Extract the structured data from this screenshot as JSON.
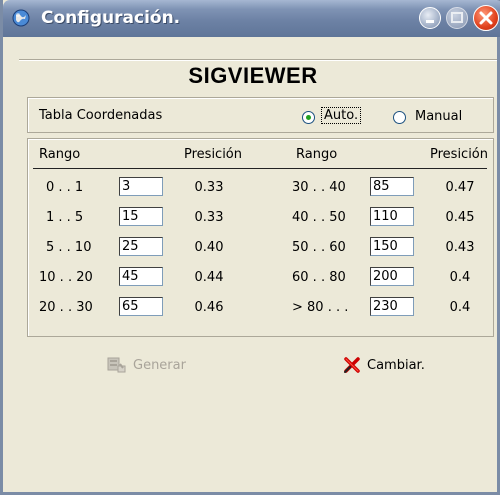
{
  "window": {
    "title": "Configuración.",
    "icons": {
      "app": "globe-icon",
      "minimize": "minimize-icon",
      "maximize": "maximize-icon",
      "close": "close-icon"
    }
  },
  "header": {
    "app_title": "SIGVIEWER"
  },
  "mode": {
    "label": "Tabla Coordenadas",
    "options": [
      {
        "label": "Auto.",
        "checked": true
      },
      {
        "label": "Manual",
        "checked": false
      }
    ]
  },
  "table": {
    "headers": {
      "rango1": "Rango",
      "precision1": "Presición",
      "rango2": "Rango",
      "precision2": "Presición"
    },
    "left": [
      {
        "rango": "0 . . 1",
        "value": "3",
        "precision": "0.33"
      },
      {
        "rango": "1 . . 5",
        "value": "15",
        "precision": "0.33"
      },
      {
        "rango": "5 . . 10",
        "value": "25",
        "precision": "0.40"
      },
      {
        "rango": "10 . . 20",
        "value": "45",
        "precision": "0.44"
      },
      {
        "rango": "20 . . 30",
        "value": "65",
        "precision": "0.46"
      }
    ],
    "right": [
      {
        "rango": "30 . . 40",
        "value": "85",
        "precision": "0.47"
      },
      {
        "rango": "40 . . 50",
        "value": "110",
        "precision": "0.45"
      },
      {
        "rango": "50 . . 60",
        "value": "150",
        "precision": "0.43"
      },
      {
        "rango": "60 . . 80",
        "value": "200",
        "precision": "0.4"
      },
      {
        "rango": "> 80 . . .",
        "value": "230",
        "precision": "0.4"
      }
    ]
  },
  "buttons": {
    "generar": {
      "label": "Generar",
      "enabled": false,
      "icon": "generate-icon"
    },
    "cambiar": {
      "label": "Cambiar.",
      "enabled": true,
      "icon": "red-x-icon"
    }
  },
  "colors": {
    "titlebar": "#6d82a5",
    "face": "#ece9d8",
    "radio_dot": "#21a121",
    "cambiar_x": "#cc0000"
  }
}
